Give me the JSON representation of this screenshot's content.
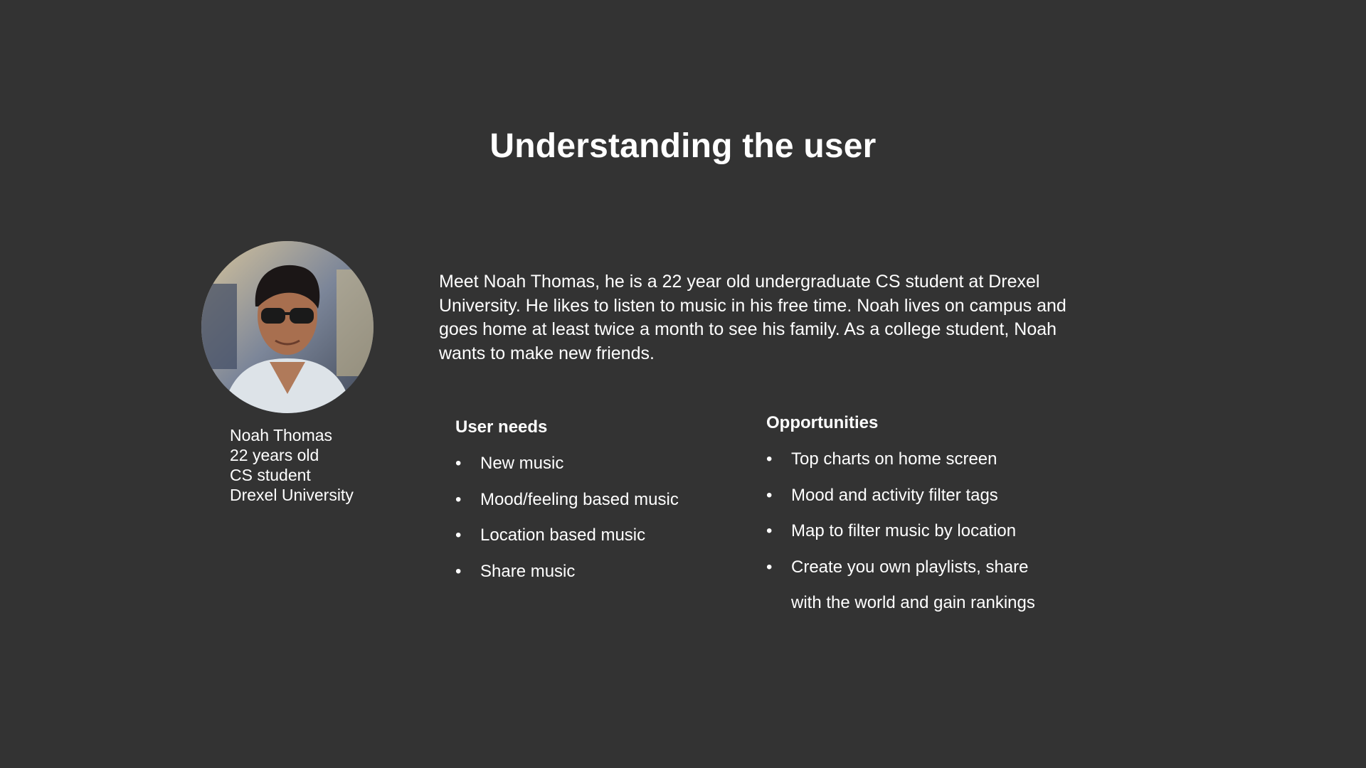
{
  "title": "Understanding the user",
  "persona": {
    "name": "Noah Thomas",
    "age": "22 years old",
    "role": "CS student",
    "school": "Drexel University"
  },
  "intro": "Meet Noah Thomas, he is a 22 year old undergraduate CS student at Drexel University. He likes to listen to music in his free time. Noah lives on campus and goes home at least twice a month to see his family. As a college student, Noah wants to make new friends.",
  "user_needs": {
    "heading": "User needs",
    "items": [
      "New music",
      "Mood/feeling based music",
      "Location based music",
      "Share music"
    ]
  },
  "opportunities": {
    "heading": "Opportunities",
    "items": [
      "Top charts on home screen",
      "Mood and activity filter tags",
      "Map to filter music by location",
      "Create you own playlists, share with the world and gain rankings"
    ]
  },
  "bullet_char": "•"
}
